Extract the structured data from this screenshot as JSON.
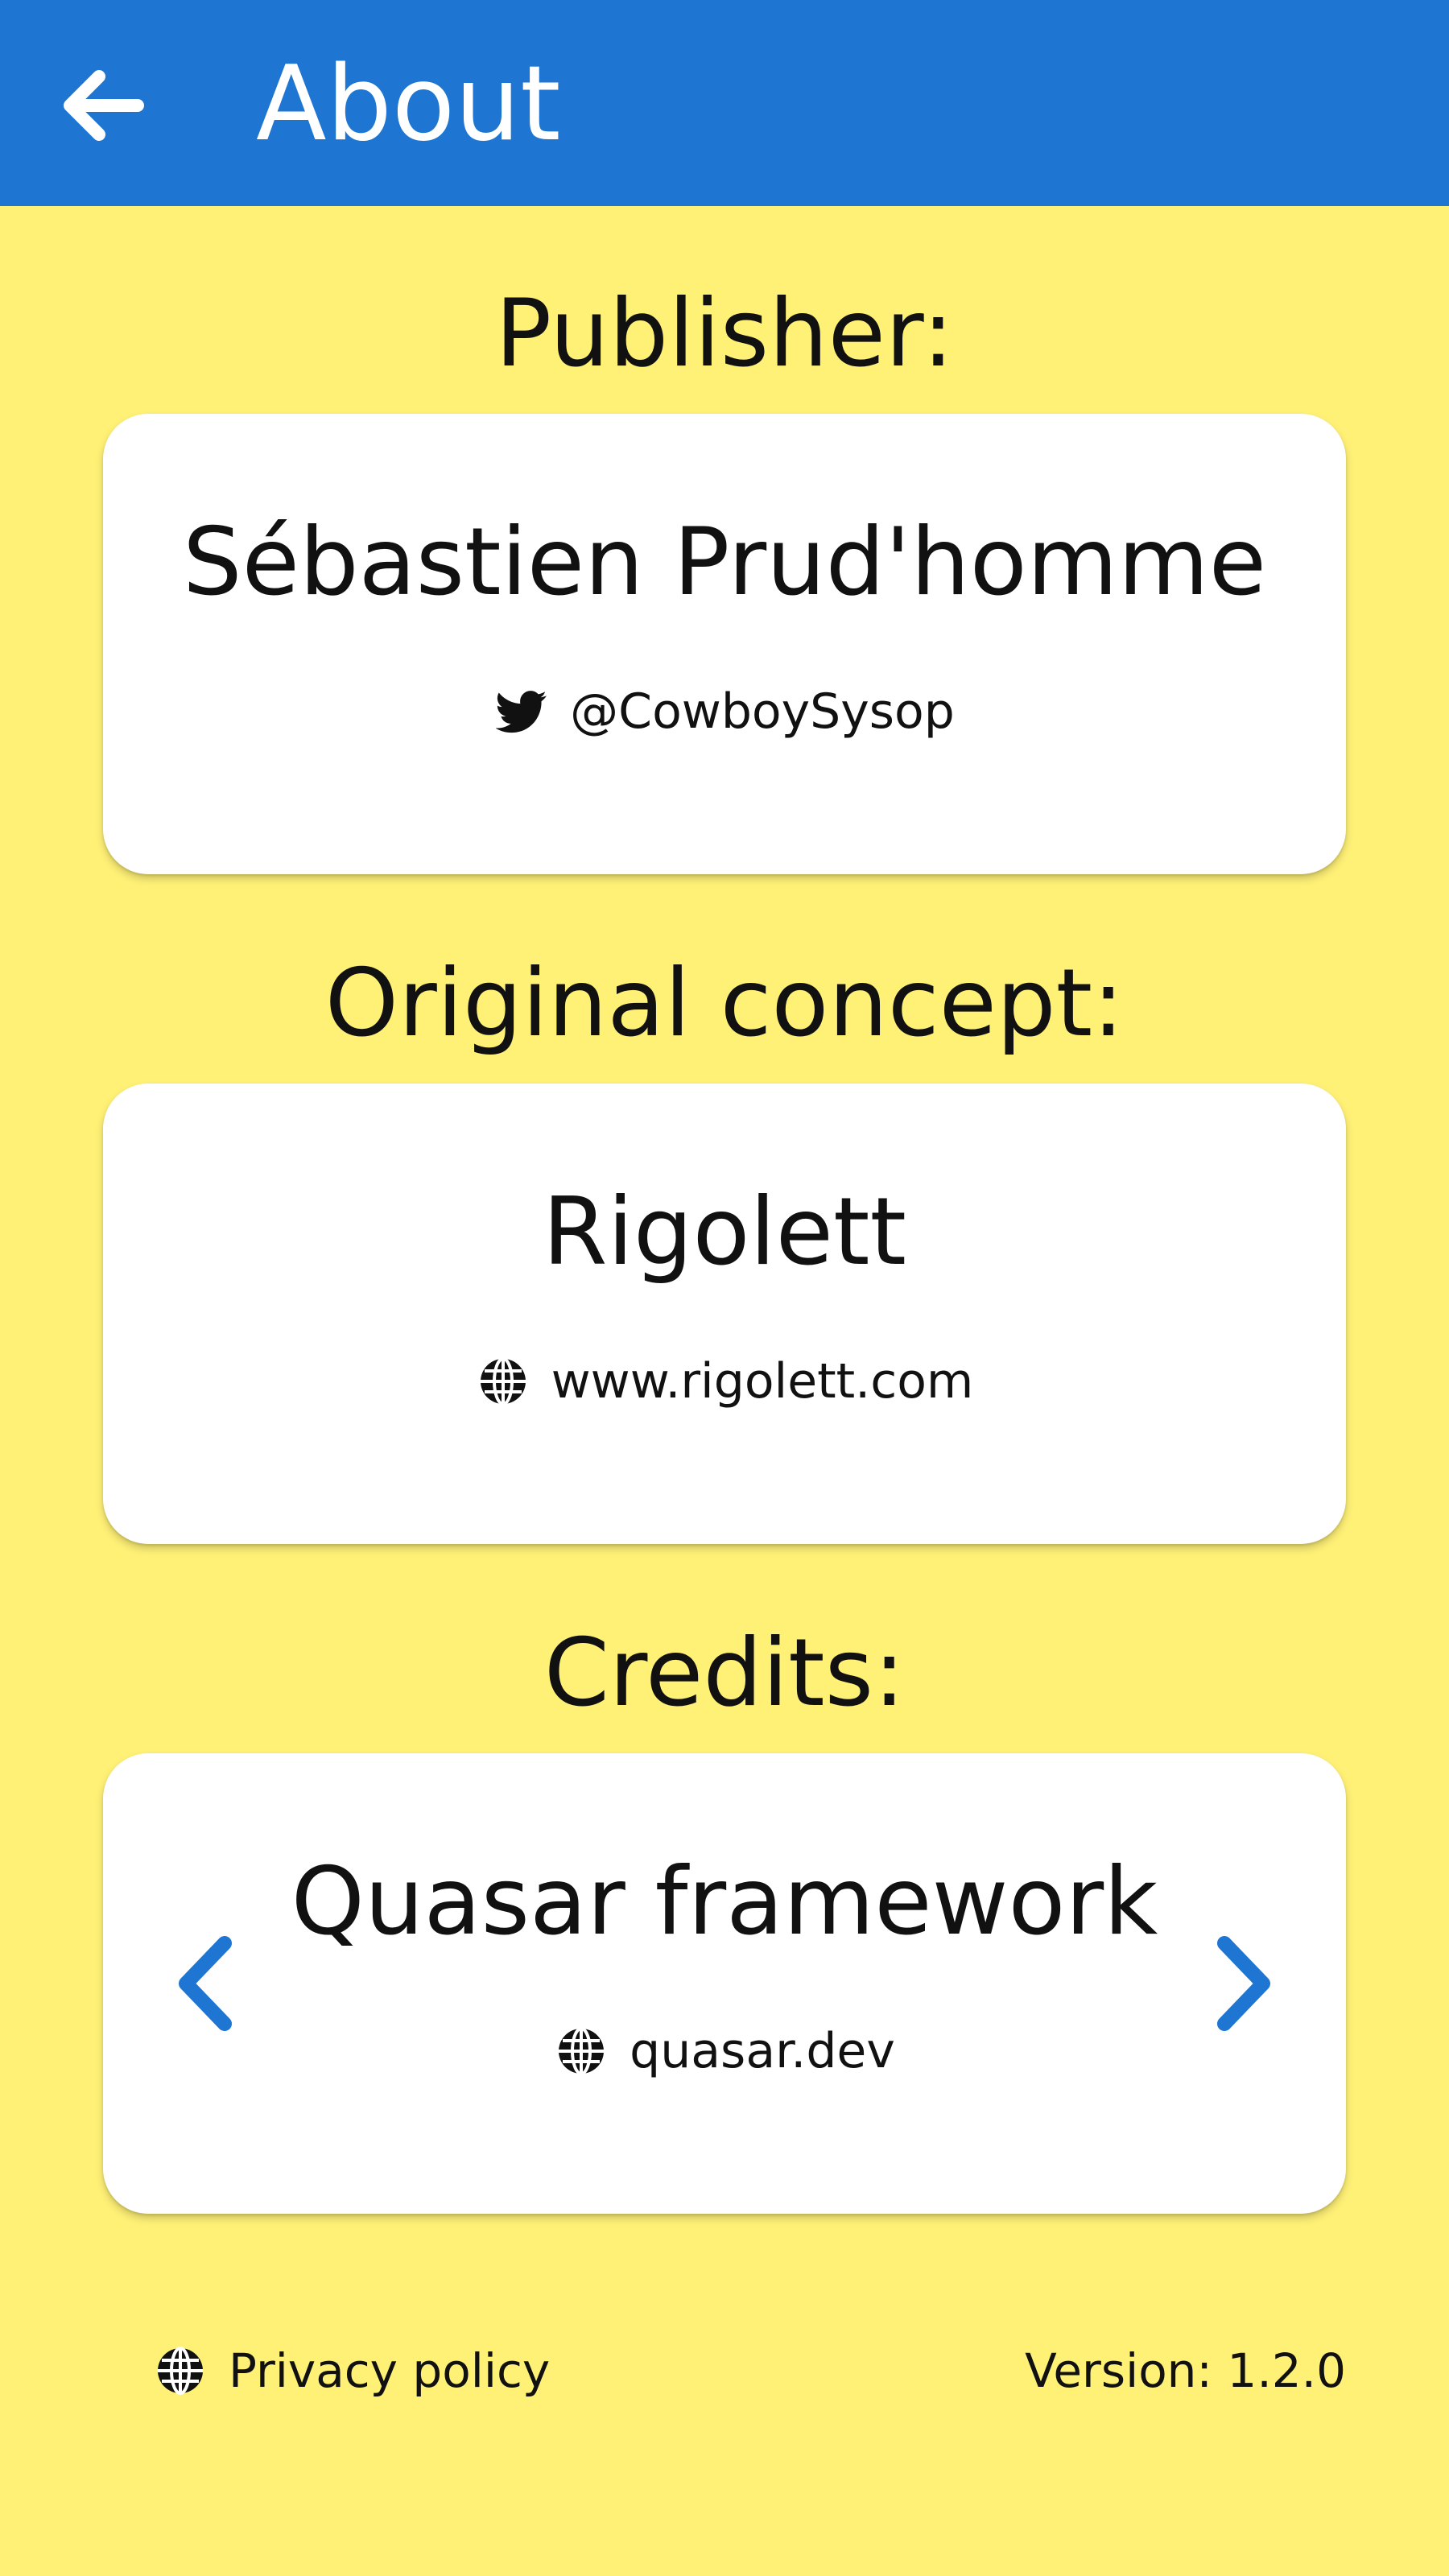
{
  "header": {
    "title": "About",
    "back_icon": "arrow-left-icon",
    "background_color": "#1E76D2"
  },
  "colors": {
    "page_background": "#FFF176",
    "card_background": "#FFFFFF",
    "accent": "#1E76D2",
    "text": "#111111"
  },
  "publisher": {
    "heading": "Publisher:",
    "name": "Sébastien Prud'homme",
    "link_icon": "twitter-icon",
    "link_text": "@CowboySysop"
  },
  "concept": {
    "heading": "Original concept:",
    "name": "Rigolett",
    "link_icon": "globe-icon",
    "link_text": "www.rigolett.com"
  },
  "credits": {
    "heading": "Credits:",
    "name": "Quasar framework",
    "link_icon": "globe-icon",
    "link_text": "quasar.dev",
    "prev_icon": "chevron-left-icon",
    "next_icon": "chevron-right-icon"
  },
  "footer": {
    "privacy_icon": "globe-icon",
    "privacy_label": "Privacy policy",
    "version_label": "Version: 1.2.0"
  }
}
